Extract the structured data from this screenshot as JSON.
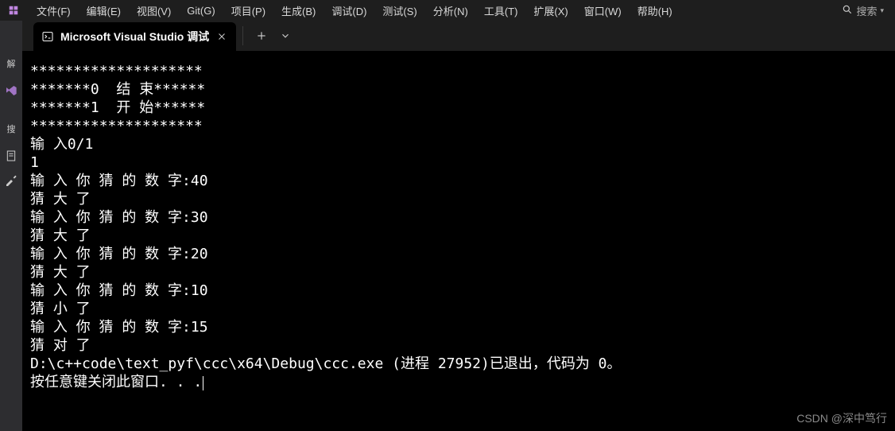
{
  "menu": {
    "items": [
      "文件(F)",
      "编辑(E)",
      "视图(V)",
      "Git(G)",
      "项目(P)",
      "生成(B)",
      "调试(D)",
      "测试(S)",
      "分析(N)",
      "工具(T)",
      "扩展(X)",
      "窗口(W)",
      "帮助(H)"
    ]
  },
  "search": {
    "label": "搜索",
    "chevron": "▾"
  },
  "tab": {
    "title": "Microsoft Visual Studio 调试"
  },
  "sidebar": {
    "label1": "解",
    "label2": "搜"
  },
  "console": {
    "lines": [
      "********************",
      "*******0  结 束******",
      "*******1  开 始******",
      "********************",
      "输 入0/1",
      "1",
      "输 入 你 猜 的 数 字:40",
      "猜 大 了",
      "输 入 你 猜 的 数 字:30",
      "猜 大 了",
      "输 入 你 猜 的 数 字:20",
      "猜 大 了",
      "输 入 你 猜 的 数 字:10",
      "猜 小 了",
      "输 入 你 猜 的 数 字:15",
      "猜 对 了",
      "D:\\c++code\\text_pyf\\ccc\\x64\\Debug\\ccc.exe (进程 27952)已退出，代码为 0。",
      "按任意键关闭此窗口. . ."
    ]
  },
  "watermark": "CSDN @深中笃行"
}
